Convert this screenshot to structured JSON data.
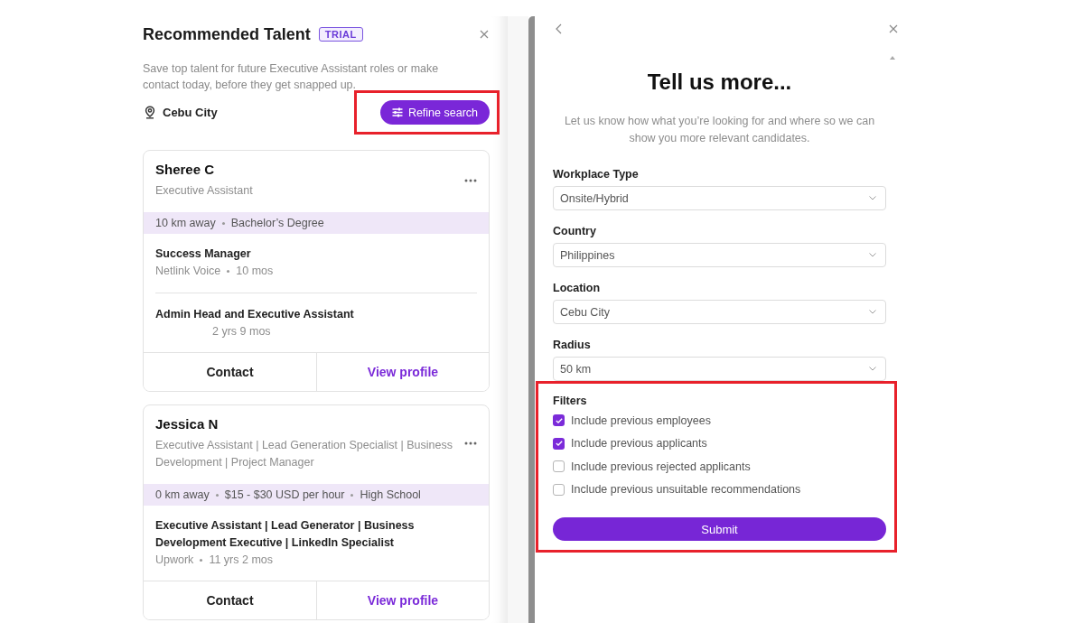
{
  "panel": {
    "title": "Recommended Talent",
    "badge": "TRIAL",
    "description": "Save top talent for future Executive Assistant roles or make contact today, before they get snapped up.",
    "location": "Cebu City",
    "refine_button": "Refine search"
  },
  "candidates": [
    {
      "name": "Sheree C",
      "role": "Executive Assistant",
      "details": [
        "10 km away",
        "Bachelor’s Degree"
      ],
      "experience": [
        {
          "title": "Success Manager",
          "company": "Netlink Voice",
          "duration": "10 mos"
        },
        {
          "title": "Admin Head and Executive Assistant",
          "duration": "2 yrs 9 mos"
        }
      ],
      "actions": [
        {
          "label": "Contact",
          "kind": "plain"
        },
        {
          "label": "View profile",
          "kind": "accent"
        }
      ]
    },
    {
      "name": "Jessica N",
      "role": "Executive Assistant | Lead Generation Specialist | Business Development | Project Manager",
      "details": [
        "0 km away",
        "$15 - $30 USD per hour",
        "High School"
      ],
      "experience": [
        {
          "title": "Executive Assistant | Lead Generator | Business Development Executive | LinkedIn Specialist",
          "company": "Upwork",
          "duration": "11 yrs 2 mos"
        }
      ],
      "actions": [
        {
          "label": "Contact",
          "kind": "plain"
        },
        {
          "label": "View profile",
          "kind": "accent"
        }
      ]
    }
  ],
  "form": {
    "title": "Tell us more...",
    "description": "Let us know how what you’re looking for and where so we can show you more relevant candidates.",
    "fields": [
      {
        "label": "Workplace Type",
        "value": "Onsite/Hybrid"
      },
      {
        "label": "Country",
        "value": "Philippines"
      },
      {
        "label": "Location",
        "value": "Cebu City"
      },
      {
        "label": "Radius",
        "value": "50 km"
      }
    ],
    "filters_label": "Filters",
    "filters": [
      {
        "label": "Include previous employees",
        "checked": true
      },
      {
        "label": "Include previous applicants",
        "checked": true
      },
      {
        "label": "Include previous rejected applicants",
        "checked": false
      },
      {
        "label": "Include previous unsuitable recommendations",
        "checked": false
      }
    ],
    "submit": "Submit"
  }
}
